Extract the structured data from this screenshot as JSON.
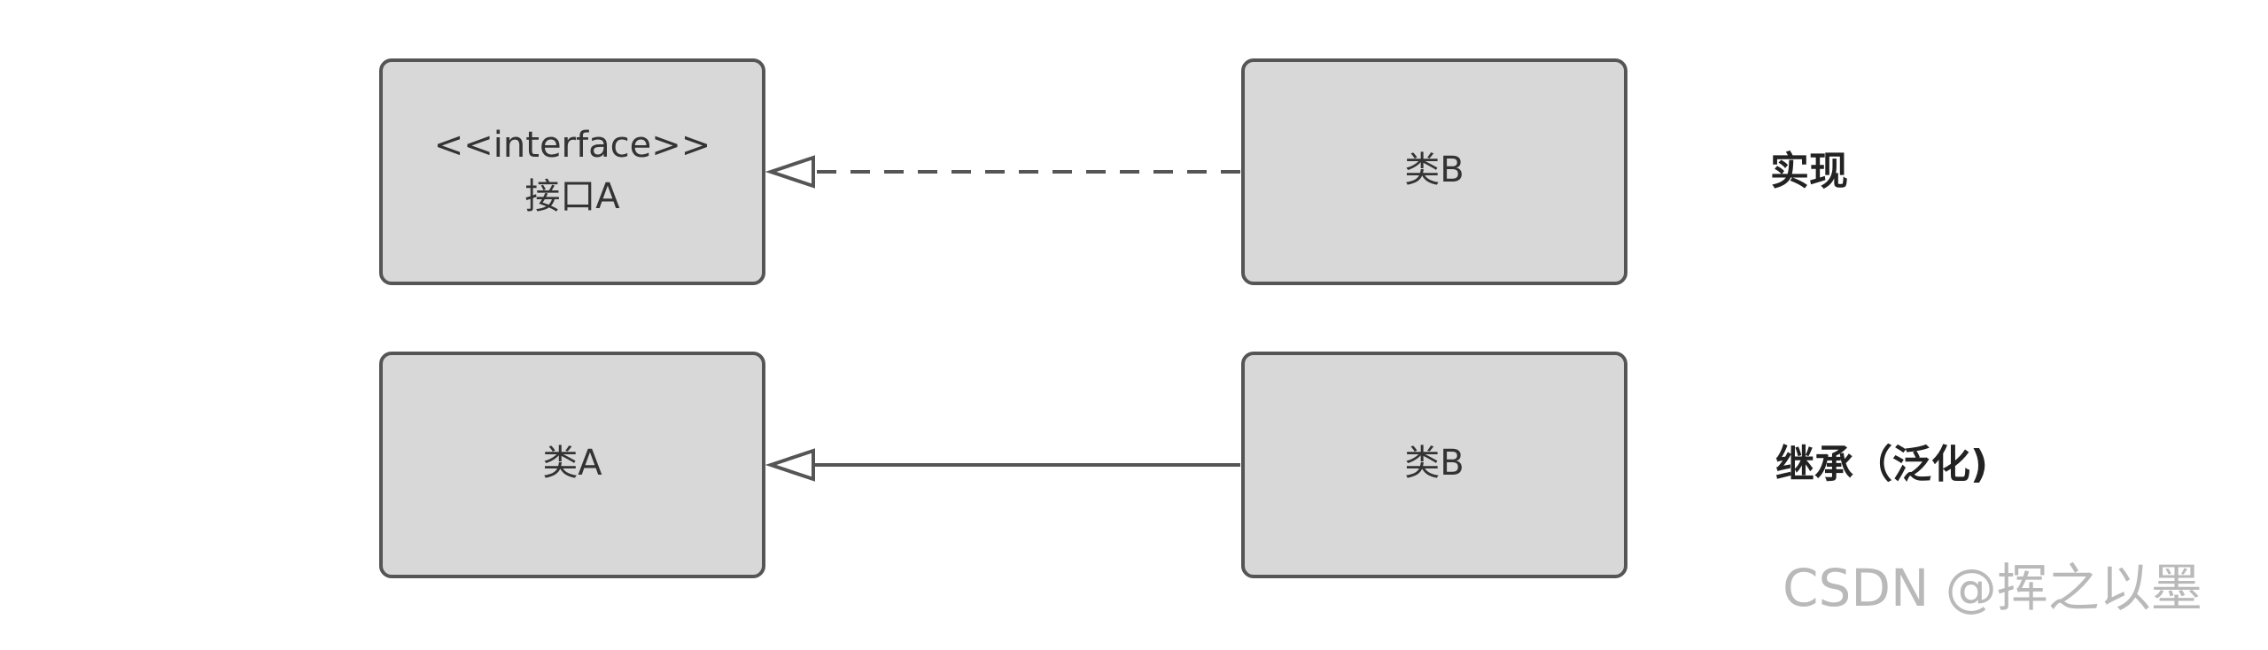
{
  "top_row": {
    "interface_box": {
      "stereotype": "<<interface>>",
      "name": "接口A"
    },
    "class_box": {
      "name": "类B"
    },
    "relation_label": "实现"
  },
  "bottom_row": {
    "parent_box": {
      "name": "类A"
    },
    "child_box": {
      "name": "类B"
    },
    "relation_label": "继承（泛化)"
  },
  "watermark": "CSDN @挥之以墨",
  "colors": {
    "box_fill": "#d8d8d8",
    "box_stroke": "#555555",
    "line": "#555555",
    "label": "#222222",
    "watermark": "#b9b9b9"
  }
}
